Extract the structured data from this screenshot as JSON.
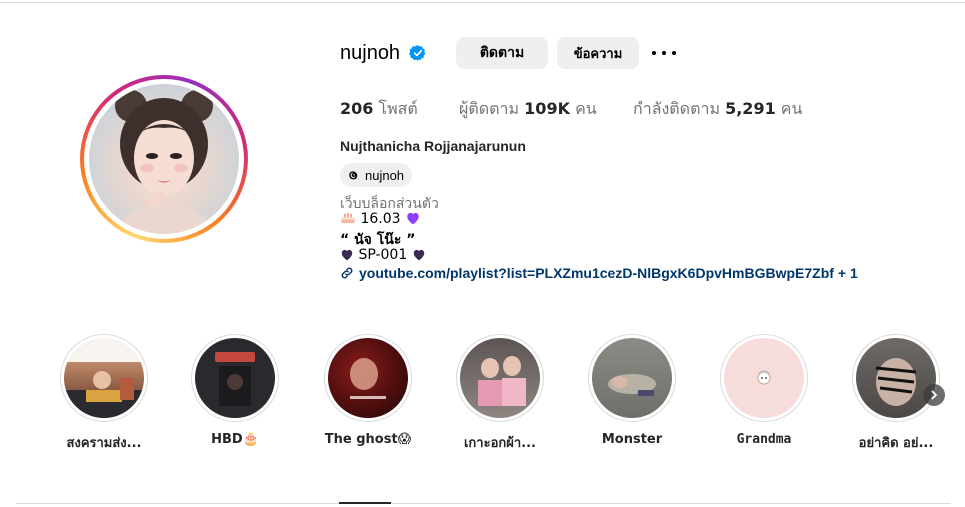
{
  "profile": {
    "username": "nujnoh",
    "follow_label": "ติดตาม",
    "message_label": "ข้อความ",
    "full_name": "Nujthanicha Rojjanajarunun",
    "threads_handle": "nujnoh",
    "category": "เว็บบล็อกส่วนตัว"
  },
  "stats": {
    "posts_count": "206",
    "posts_label": "โพสต์",
    "followers_label": "ผู้ติดตาม",
    "followers_count": "109K",
    "followers_unit": "คน",
    "following_label": "กำลังติดตาม",
    "following_count": "5,291",
    "following_unit": "คน"
  },
  "bio": {
    "line1_text": "16.03",
    "line2_text": "“ นัจ โน๊ะ ”",
    "line3_text": "SP-001",
    "link_text": "youtube.com/playlist?list=PLXZmu1cezD-NlBgxK6DpvHmBGBwpE7Zbf",
    "link_extra": "+ 1"
  },
  "highlights": [
    {
      "label": "สงครามส่ง..."
    },
    {
      "label": "HBD🎂"
    },
    {
      "label": "The ghost😱"
    },
    {
      "label": "เกาะอกผ้า..."
    },
    {
      "label": "Monster"
    },
    {
      "label": "Grandma"
    },
    {
      "label": "อย่าคิด อย่..."
    }
  ],
  "icons": {
    "verified": "verified-badge-icon",
    "more": "more-options-icon",
    "threads": "threads-icon",
    "link": "link-icon",
    "next": "chevron-right-icon"
  },
  "colors": {
    "verified_blue": "#0095f6",
    "link_blue": "#00376b",
    "button_bg": "#efefef",
    "heart_purple": "#8a3ffc"
  }
}
